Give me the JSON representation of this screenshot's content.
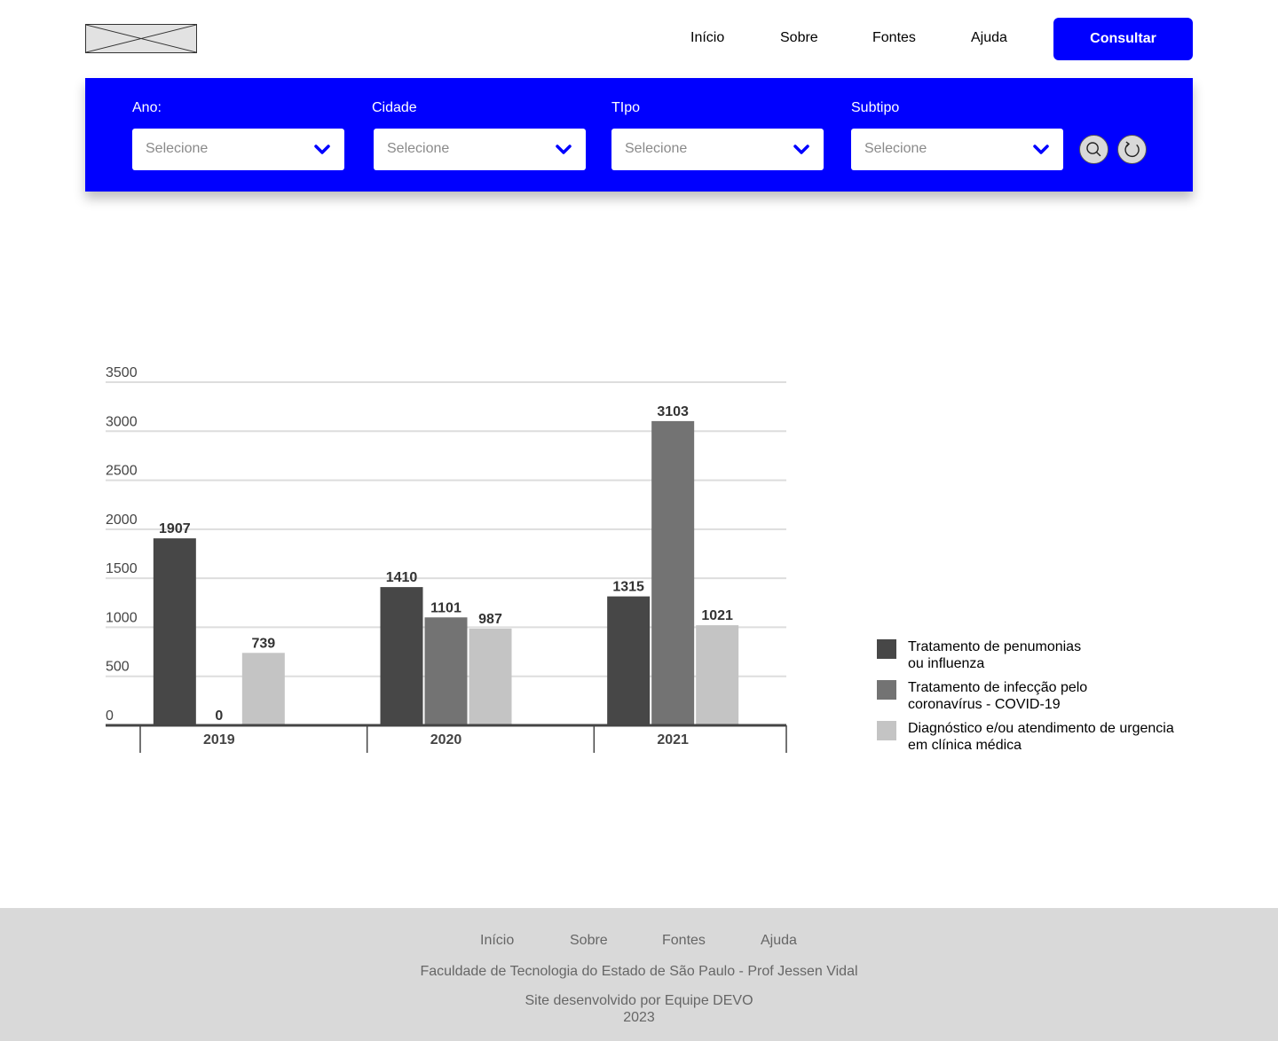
{
  "header": {
    "logo": "logo-placeholder",
    "nav": [
      "Início",
      "Sobre",
      "Fontes",
      "Ajuda"
    ],
    "cta_label": "Consultar"
  },
  "filters": {
    "fields": [
      {
        "label": "Ano:",
        "placeholder": "Selecione"
      },
      {
        "label": "Cidade",
        "placeholder": "Selecione"
      },
      {
        "label": "TIpo",
        "placeholder": "Selecione"
      },
      {
        "label": "Subtipo",
        "placeholder": "Selecione"
      }
    ],
    "icons": {
      "search": "search-icon",
      "refresh": "refresh-icon",
      "dropdown": "chevron-down-icon"
    }
  },
  "chart_data": {
    "type": "bar",
    "categories": [
      "2019",
      "2020",
      "2021"
    ],
    "series": [
      {
        "name": "Tratamento de penumonias\nou influenza",
        "values": [
          1907,
          1410,
          1315
        ],
        "color": "#474747"
      },
      {
        "name": "Tratamento de infecção pelo\ncoronavírus - COVID-19",
        "values": [
          0,
          1101,
          3103
        ],
        "color": "#737373"
      },
      {
        "name": "Diagnóstico e/ou atendimento de urgencia\nem clínica médica",
        "values": [
          739,
          987,
          1021
        ],
        "color": "#c4c4c4"
      }
    ],
    "ylim": [
      0,
      3500
    ],
    "yticks": [
      0,
      500,
      1000,
      1500,
      2000,
      2500,
      3000,
      3500
    ],
    "grid": true,
    "legend": "right",
    "title": "",
    "xlabel": "",
    "ylabel": ""
  },
  "footer": {
    "nav": [
      "Início",
      "Sobre",
      "Fontes",
      "Ajuda"
    ],
    "institution": "Faculdade de Tecnologia do Estado de São Paulo - Prof Jessen Vidal",
    "credits": "Site desenvolvido por Equipe DEVO",
    "year": "2023"
  },
  "colors": {
    "accent": "#0000ff",
    "footer_bg": "#d9d9d9",
    "footer_text": "#666666"
  }
}
